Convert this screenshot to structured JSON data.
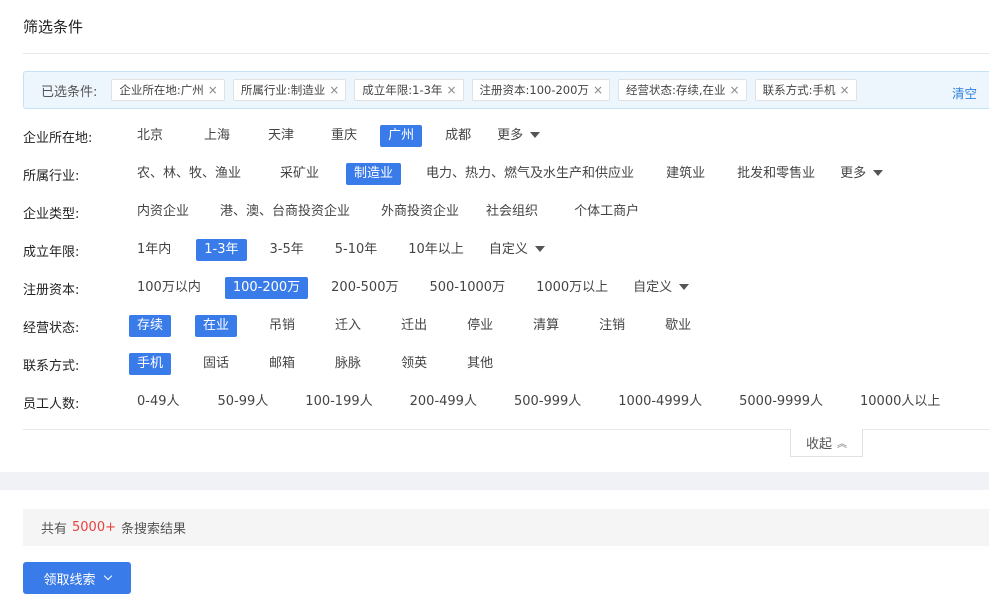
{
  "panel": {
    "title": "筛选条件"
  },
  "selected": {
    "label": "已选条件:",
    "chips": [
      "企业所在地:广州",
      "所属行业:制造业",
      "成立年限:1-3年",
      "注册资本:100-200万",
      "经营状态:存续,在业",
      "联系方式:手机"
    ],
    "close_glyph": "×",
    "clear_label": "清空"
  },
  "filters": {
    "location": {
      "label": "企业所在地:",
      "options": [
        "北京",
        "上海",
        "天津",
        "重庆",
        "广州",
        "成都"
      ],
      "active": [
        "广州"
      ],
      "more_label": "更多"
    },
    "industry": {
      "label": "所属行业:",
      "options": [
        "农、林、牧、渔业",
        "采矿业",
        "制造业",
        "电力、热力、燃气及水生产和供应业",
        "建筑业",
        "批发和零售业"
      ],
      "active": [
        "制造业"
      ],
      "more_label": "更多"
    },
    "company_type": {
      "label": "企业类型:",
      "options": [
        "内资企业",
        "港、澳、台商投资企业",
        "外商投资企业",
        "社会组织",
        "个体工商户"
      ],
      "active": []
    },
    "established": {
      "label": "成立年限:",
      "options": [
        "1年内",
        "1-3年",
        "3-5年",
        "5-10年",
        "10年以上"
      ],
      "active": [
        "1-3年"
      ],
      "custom_label": "自定义"
    },
    "capital": {
      "label": "注册资本:",
      "options": [
        "100万以内",
        "100-200万",
        "200-500万",
        "500-1000万",
        "1000万以上"
      ],
      "active": [
        "100-200万"
      ],
      "custom_label": "自定义"
    },
    "status": {
      "label": "经营状态:",
      "options": [
        "存续",
        "在业",
        "吊销",
        "迁入",
        "迁出",
        "停业",
        "清算",
        "注销",
        "歇业"
      ],
      "active": [
        "存续",
        "在业"
      ]
    },
    "contact": {
      "label": "联系方式:",
      "options": [
        "手机",
        "固话",
        "邮箱",
        "脉脉",
        "领英",
        "其他"
      ],
      "active": [
        "手机"
      ]
    },
    "employees": {
      "label": "员工人数:",
      "options": [
        "0-49人",
        "50-99人",
        "100-199人",
        "200-499人",
        "500-999人",
        "1000-4999人",
        "5000-9999人",
        "10000人以上"
      ],
      "active": []
    }
  },
  "collapse": {
    "label": "收起",
    "glyph": "︽"
  },
  "results": {
    "prefix": "共有",
    "count": "5000+",
    "suffix": "条搜索结果"
  },
  "action_button": {
    "label": "领取线索"
  },
  "colors": {
    "accent": "#3a7bea",
    "count_red": "#e94141",
    "selected_bg": "#eef6fd"
  }
}
